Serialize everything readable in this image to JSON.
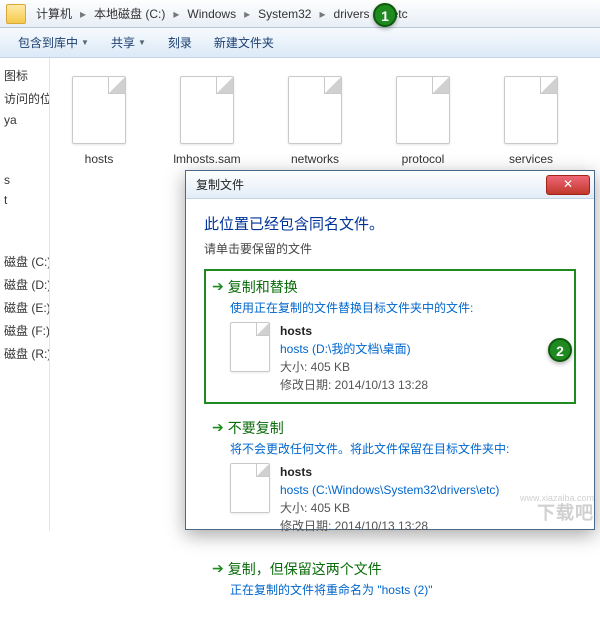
{
  "breadcrumb": [
    "计算机",
    "本地磁盘 (C:)",
    "Windows",
    "System32",
    "drivers",
    "etc"
  ],
  "toolbar": {
    "include": "包含到库中",
    "share": "共享",
    "burn": "刻录",
    "newfolder": "新建文件夹"
  },
  "sidebar": {
    "items": [
      "",
      "图标",
      "访问的位置",
      "ya"
    ],
    "mid": [
      "s",
      "t"
    ],
    "drives": [
      "磁盘 (C:)",
      "磁盘 (D:)",
      "磁盘 (E:)",
      "磁盘 (F:)",
      "磁盘 (R:)"
    ]
  },
  "files": [
    "hosts",
    "lmhosts.sam",
    "networks",
    "protocol",
    "services"
  ],
  "dialog": {
    "title": "复制文件",
    "heading": "此位置已经包含同名文件。",
    "sub": "请单击要保留的文件",
    "opt1": {
      "title": "复制和替换",
      "desc": "使用正在复制的文件替换目标文件夹中的文件:",
      "file": {
        "name": "hosts",
        "path": "hosts (D:\\我的文档\\桌面)",
        "size": "大小: 405 KB",
        "date": "修改日期: 2014/10/13 13:28"
      }
    },
    "opt2": {
      "title": "不要复制",
      "desc": "将不会更改任何文件。将此文件保留在目标文件夹中:",
      "file": {
        "name": "hosts",
        "path": "hosts (C:\\Windows\\System32\\drivers\\etc)",
        "size": "大小: 405 KB",
        "date": "修改日期: 2014/10/13 13:28"
      }
    },
    "opt3": {
      "title": "复制，但保留这两个文件",
      "desc": "正在复制的文件将重命名为 \"hosts (2)\""
    }
  },
  "markers": {
    "m1": "1",
    "m2": "2"
  },
  "watermark": {
    "big": "下载吧",
    "small": "www.xiazaiba.com"
  }
}
